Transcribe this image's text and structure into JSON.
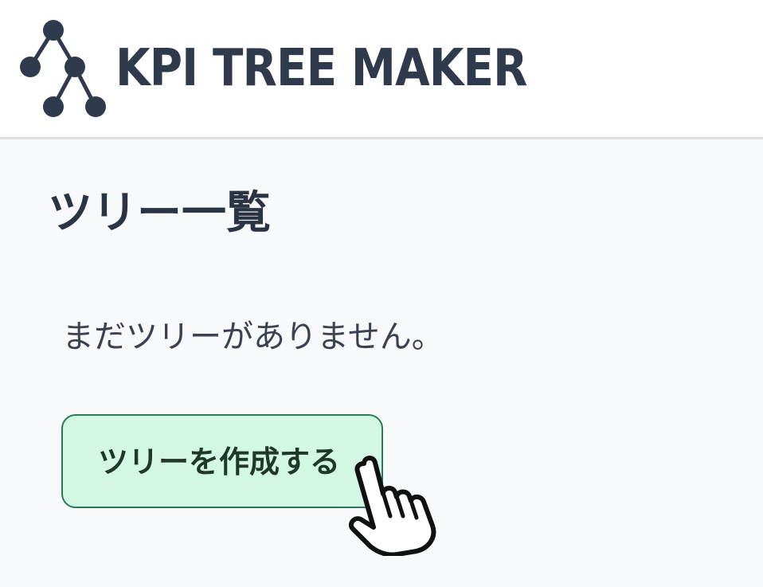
{
  "header": {
    "app_title": "KPI TREE MAKER",
    "logo_icon": "tree-diagram-icon"
  },
  "main": {
    "page_title": "ツリー一覧",
    "empty_message": "まだツリーがありません。",
    "create_button_label": "ツリーを作成する"
  },
  "cursor": {
    "icon": "hand-pointer-icon"
  },
  "colors": {
    "header_bg": "#ffffff",
    "page_bg": "#f8f9fb",
    "text_dark": "#2f3a4d",
    "button_bg": "#d2f7e3",
    "button_border": "#2c7a55",
    "divider": "#dcdee2"
  }
}
